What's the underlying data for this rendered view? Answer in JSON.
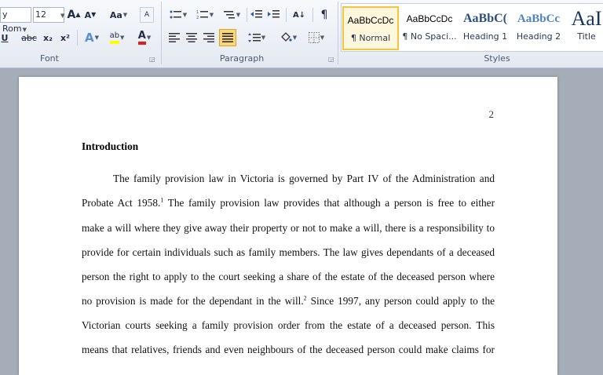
{
  "ribbon": {
    "font": {
      "font_name": "y Rom",
      "font_size": "12",
      "grow_label": "A",
      "shrink_label": "A",
      "change_case_label": "Aa",
      "clear_label": "A",
      "underline_label": "U",
      "strike_label": "abc",
      "subscript_label": "x₂",
      "superscript_label": "x²",
      "effects_label": "A",
      "highlight_label": "ab",
      "color_label": "A",
      "group_label": "Font"
    },
    "paragraph": {
      "sort_label": "A↓",
      "pilcrow_label": "¶",
      "group_label": "Paragraph"
    },
    "styles": {
      "group_label": "Styles",
      "items": [
        {
          "sample": "AaBbCcDc",
          "name": "¶ Normal"
        },
        {
          "sample": "AaBbCcDc",
          "name": "¶ No Spaci..."
        },
        {
          "sample": "AaBbC(",
          "name": "Heading 1"
        },
        {
          "sample": "AaBbCc",
          "name": "Heading 2"
        },
        {
          "sample": "AaI",
          "name": "Title"
        }
      ]
    }
  },
  "document": {
    "page_number": "2",
    "heading": "Introduction",
    "lines": [
      "The family provision law in Victoria is governed by Part IV of the Administration and",
      "Probate Act 1958.",
      "make a will where they give away their property or not to make a will, there is a responsibility to",
      "provide for certain individuals such as family members. The law gives dependants of a deceased",
      "person the right to apply to the court seeking a share of the estate of the deceased person where",
      "no provision is made for the dependant in the will.",
      "Victorian courts seeking a family provision order from the estate of a deceased person. This",
      "means that relatives, friends and even neighbours of the deceased person could make claims for"
    ],
    "line2_sup": "1",
    "line2_rest": " The family provision law provides that although a person is free to either",
    "line6_sup": "2",
    "line6_rest": " Since 1997, any person could apply to the"
  }
}
